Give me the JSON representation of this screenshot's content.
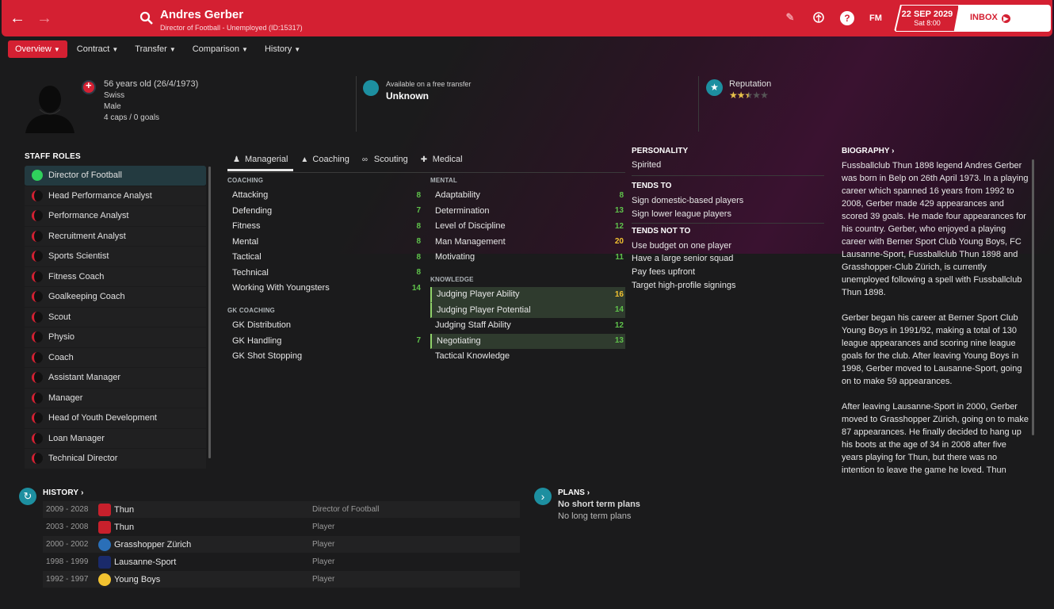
{
  "header": {
    "back_icon": "arrow-left-icon",
    "forward_icon": "arrow-right-icon",
    "search_icon": "search-icon",
    "title": "Andres Gerber",
    "subtitle": "Director of Football - Unemployed (ID:15317)",
    "date": "22 SEP 2029",
    "day_time": "Sat 8:00",
    "inbox_label": "INBOX",
    "fm_label": "FM",
    "accent": "#d42032"
  },
  "tabs": [
    "Overview",
    "Contract",
    "Transfer",
    "Comparison",
    "History"
  ],
  "profile": {
    "age": "56 years old (26/4/1973)",
    "nationality": "Swiss",
    "gender": "Male",
    "caps": "4 caps / 0 goals",
    "transfer_label": "Available on a free transfer",
    "transfer_value": "Unknown",
    "reputation_label": "Reputation",
    "reputation_stars": 2.5,
    "reputation_max": 5
  },
  "staff_roles": {
    "title": "STAFF ROLES",
    "items": [
      "Director of Football",
      "Head Performance Analyst",
      "Performance Analyst",
      "Recruitment Analyst",
      "Sports Scientist",
      "Fitness Coach",
      "Goalkeeping Coach",
      "Scout",
      "Physio",
      "Coach",
      "Assistant Manager",
      "Manager",
      "Head of Youth Development",
      "Loan Manager",
      "Technical Director"
    ]
  },
  "attr_tabs": [
    "Managerial",
    "Coaching",
    "Scouting",
    "Medical"
  ],
  "attributes": {
    "coaching_head": "COACHING",
    "coaching": [
      {
        "name": "Attacking",
        "value": "8"
      },
      {
        "name": "Defending",
        "value": "7"
      },
      {
        "name": "Fitness",
        "value": "8"
      },
      {
        "name": "Mental",
        "value": "8"
      },
      {
        "name": "Tactical",
        "value": "8"
      },
      {
        "name": "Technical",
        "value": "8"
      },
      {
        "name": "Working With Youngsters",
        "value": "14"
      }
    ],
    "gk_head": "GK COACHING",
    "gk": [
      {
        "name": "GK Distribution",
        "value": ""
      },
      {
        "name": "GK Handling",
        "value": "7"
      },
      {
        "name": "GK Shot Stopping",
        "value": ""
      }
    ],
    "mental_head": "MENTAL",
    "mental": [
      {
        "name": "Adaptability",
        "value": "8"
      },
      {
        "name": "Determination",
        "value": "13"
      },
      {
        "name": "Level of Discipline",
        "value": "12"
      },
      {
        "name": "Man Management",
        "value": "20"
      },
      {
        "name": "Motivating",
        "value": "11"
      }
    ],
    "knowledge_head": "KNOWLEDGE",
    "knowledge": [
      {
        "name": "Judging Player Ability",
        "value": "16"
      },
      {
        "name": "Judging Player Potential",
        "value": "14"
      },
      {
        "name": "Judging Staff Ability",
        "value": "12"
      },
      {
        "name": "Negotiating",
        "value": "13"
      },
      {
        "name": "Tactical Knowledge",
        "value": ""
      }
    ]
  },
  "personality": {
    "head": "PERSONALITY",
    "value": "Spirited",
    "tends_to_head": "TENDS TO",
    "tends_to": [
      "Sign domestic-based players",
      "Sign lower league players"
    ],
    "tends_not_head": "TENDS NOT TO",
    "tends_not": [
      "Use budget on one player",
      "Have a large senior squad",
      "Pay fees upfront",
      "Target high-profile signings"
    ]
  },
  "biography": {
    "head": "BIOGRAPHY",
    "p1": "Fussballclub Thun 1898 legend Andres Gerber was born in Belp on 26th April 1973. In a playing career which spanned 16 years from 1992 to 2008, Gerber made 429 appearances and scored 39 goals. He made four appearances for his country. Gerber, who enjoyed a playing career with Berner Sport Club Young Boys, FC Lausanne-Sport, Fussballclub Thun 1898 and Grasshopper-Club Zürich, is currently unemployed following a spell with Fussballclub Thun 1898.",
    "p2": "Gerber began his career at Berner Sport Club Young Boys in 1991/92, making a total of 130 league appearances and scoring nine league goals for the club. After leaving Young Boys in 1998, Gerber moved to Lausanne-Sport, going on to make 59 appearances.",
    "p3": "After leaving Lausanne-Sport in 2000, Gerber moved to Grasshopper Zürich, going on to make 87 appearances. He finally decided to hang up his boots at the age of 34 in 2008 after five years playing for Thun, but there was no intention to leave the game he loved. Thun"
  },
  "history": {
    "head": "HISTORY",
    "rows": [
      {
        "years": "2009 - 2028",
        "club": "Thun",
        "role": "Director of Football"
      },
      {
        "years": "2003 - 2008",
        "club": "Thun",
        "role": "Player"
      },
      {
        "years": "2000 - 2002",
        "club": "Grasshopper Zürich",
        "role": "Player"
      },
      {
        "years": "1998 - 1999",
        "club": "Lausanne-Sport",
        "role": "Player"
      },
      {
        "years": "1992 - 1997",
        "club": "Young Boys",
        "role": "Player"
      }
    ]
  },
  "plans": {
    "head": "PLANS",
    "short": "No short term plans",
    "long": "No long term plans"
  }
}
